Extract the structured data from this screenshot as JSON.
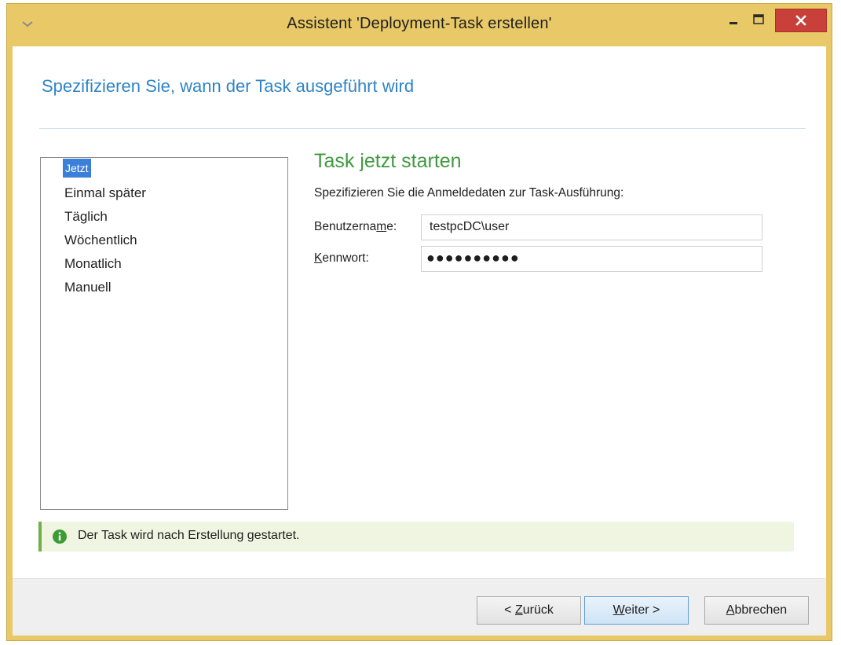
{
  "window": {
    "title": "Assistent 'Deployment-Task erstellen'"
  },
  "page": {
    "title": "Spezifizieren Sie, wann der Task ausgeführt wird"
  },
  "schedule_options": [
    {
      "label": "Jetzt",
      "selected": true
    },
    {
      "label": "Einmal später",
      "selected": false
    },
    {
      "label": "Täglich",
      "selected": false
    },
    {
      "label": "Wöchentlich",
      "selected": false
    },
    {
      "label": "Monatlich",
      "selected": false
    },
    {
      "label": "Manuell",
      "selected": false
    }
  ],
  "detail": {
    "heading": "Task jetzt starten",
    "prompt": "Spezifizieren Sie die Anmeldedaten zur Task-Ausführung:",
    "username_label": {
      "pre": "Benutzerna",
      "accel": "m",
      "post": "e:"
    },
    "username_value": "testpcDC\\user",
    "password_label": {
      "pre": "",
      "accel": "K",
      "post": "ennwort:"
    },
    "password_value": "●●●●●●●●●●"
  },
  "info": {
    "text": "Der Task wird nach Erstellung gestartet."
  },
  "buttons": {
    "back": {
      "pre": "< ",
      "accel": "Z",
      "post": "urück"
    },
    "next": {
      "pre": "",
      "accel": "W",
      "post": "eiter >"
    },
    "cancel": {
      "pre": "",
      "accel": "A",
      "post": "bbrechen"
    }
  },
  "colors": {
    "window_frame": "#e8c867",
    "close_button": "#c9403a",
    "page_title": "#2f84c6",
    "section_heading": "#3f9a3f",
    "selection": "#3b80d8",
    "info_accent": "#6fae48",
    "info_background": "#f0f5e2"
  },
  "icons": {
    "system_menu": "chevron-down-icon",
    "minimize": "minimize-icon",
    "maximize": "maximize-icon",
    "close": "close-icon",
    "info": "info-icon"
  }
}
